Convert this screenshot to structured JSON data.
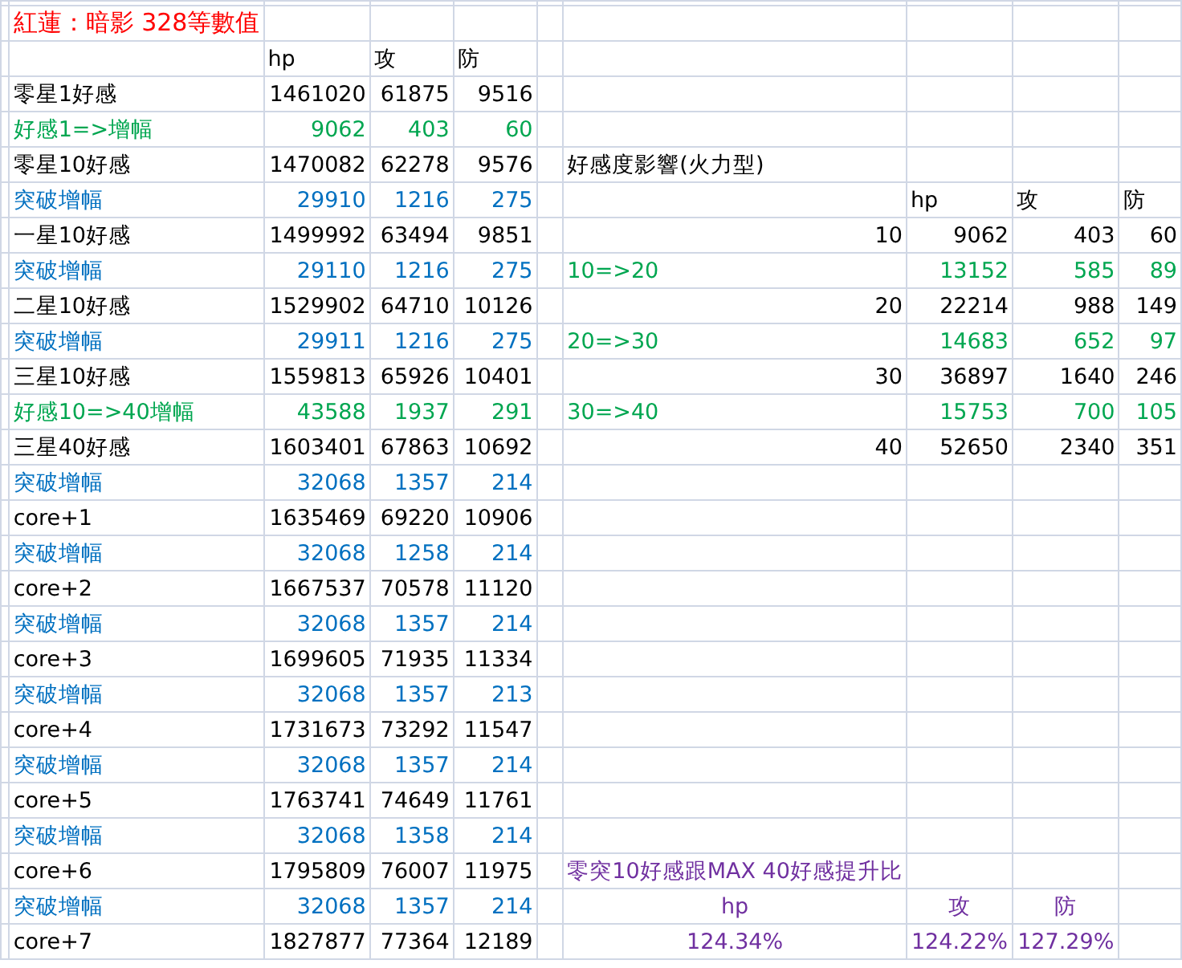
{
  "sheet_title": "紅蓮：暗影 328等數值",
  "main_table": {
    "columns": [
      "hp",
      "攻",
      "防"
    ],
    "rows": [
      {
        "label": "零星1好感",
        "kind": "base",
        "values": [
          "1461020",
          "61875",
          "9516"
        ]
      },
      {
        "label": "好感1=>增幅",
        "kind": "affection",
        "values": [
          "9062",
          "403",
          "60"
        ]
      },
      {
        "label": "零星10好感",
        "kind": "base",
        "values": [
          "1470082",
          "62278",
          "9576"
        ]
      },
      {
        "label": "突破增幅",
        "kind": "breakthrough",
        "values": [
          "29910",
          "1216",
          "275"
        ]
      },
      {
        "label": "一星10好感",
        "kind": "base",
        "values": [
          "1499992",
          "63494",
          "9851"
        ]
      },
      {
        "label": "突破增幅",
        "kind": "breakthrough",
        "values": [
          "29110",
          "1216",
          "275"
        ]
      },
      {
        "label": "二星10好感",
        "kind": "base",
        "values": [
          "1529902",
          "64710",
          "10126"
        ]
      },
      {
        "label": "突破增幅",
        "kind": "breakthrough",
        "values": [
          "29911",
          "1216",
          "275"
        ]
      },
      {
        "label": "三星10好感",
        "kind": "base",
        "values": [
          "1559813",
          "65926",
          "10401"
        ]
      },
      {
        "label": "好感10=>40增幅",
        "kind": "affection",
        "values": [
          "43588",
          "1937",
          "291"
        ]
      },
      {
        "label": "三星40好感",
        "kind": "base",
        "values": [
          "1603401",
          "67863",
          "10692"
        ]
      },
      {
        "label": "突破增幅",
        "kind": "breakthrough",
        "values": [
          "32068",
          "1357",
          "214"
        ]
      },
      {
        "label": "core+1",
        "kind": "base",
        "values": [
          "1635469",
          "69220",
          "10906"
        ]
      },
      {
        "label": "突破增幅",
        "kind": "breakthrough",
        "values": [
          "32068",
          "1258",
          "214"
        ]
      },
      {
        "label": "core+2",
        "kind": "base",
        "values": [
          "1667537",
          "70578",
          "11120"
        ]
      },
      {
        "label": "突破增幅",
        "kind": "breakthrough",
        "values": [
          "32068",
          "1357",
          "214"
        ]
      },
      {
        "label": "core+3",
        "kind": "base",
        "values": [
          "1699605",
          "71935",
          "11334"
        ]
      },
      {
        "label": "突破增幅",
        "kind": "breakthrough",
        "values": [
          "32068",
          "1357",
          "213"
        ]
      },
      {
        "label": "core+4",
        "kind": "base",
        "values": [
          "1731673",
          "73292",
          "11547"
        ]
      },
      {
        "label": "突破增幅",
        "kind": "breakthrough",
        "values": [
          "32068",
          "1357",
          "214"
        ]
      },
      {
        "label": "core+5",
        "kind": "base",
        "values": [
          "1763741",
          "74649",
          "11761"
        ]
      },
      {
        "label": "突破增幅",
        "kind": "breakthrough",
        "values": [
          "32068",
          "1358",
          "214"
        ]
      },
      {
        "label": "core+6",
        "kind": "base",
        "values": [
          "1795809",
          "76007",
          "11975"
        ]
      },
      {
        "label": "突破增幅",
        "kind": "breakthrough",
        "values": [
          "32068",
          "1357",
          "214"
        ]
      },
      {
        "label": "core+7",
        "kind": "base",
        "values": [
          "1827877",
          "77364",
          "12189"
        ]
      }
    ]
  },
  "affection_table": {
    "title": "好感度影響(火力型)",
    "columns": [
      "hp",
      "攻",
      "防"
    ],
    "rows": [
      {
        "label": "10",
        "kind": "level",
        "values": [
          "9062",
          "403",
          "60"
        ]
      },
      {
        "label": "10=>20",
        "kind": "gain",
        "values": [
          "13152",
          "585",
          "89"
        ]
      },
      {
        "label": "20",
        "kind": "level",
        "values": [
          "22214",
          "988",
          "149"
        ]
      },
      {
        "label": "20=>30",
        "kind": "gain",
        "values": [
          "14683",
          "652",
          "97"
        ]
      },
      {
        "label": "30",
        "kind": "level",
        "values": [
          "36897",
          "1640",
          "246"
        ]
      },
      {
        "label": "30=>40",
        "kind": "gain",
        "values": [
          "15753",
          "700",
          "105"
        ]
      },
      {
        "label": "40",
        "kind": "level",
        "values": [
          "52650",
          "2340",
          "351"
        ]
      }
    ]
  },
  "ratio_table": {
    "title": "零突10好感跟MAX 40好感提升比",
    "columns": [
      "hp",
      "攻",
      "防"
    ],
    "values": [
      "124.34%",
      "124.22%",
      "127.29%"
    ]
  }
}
